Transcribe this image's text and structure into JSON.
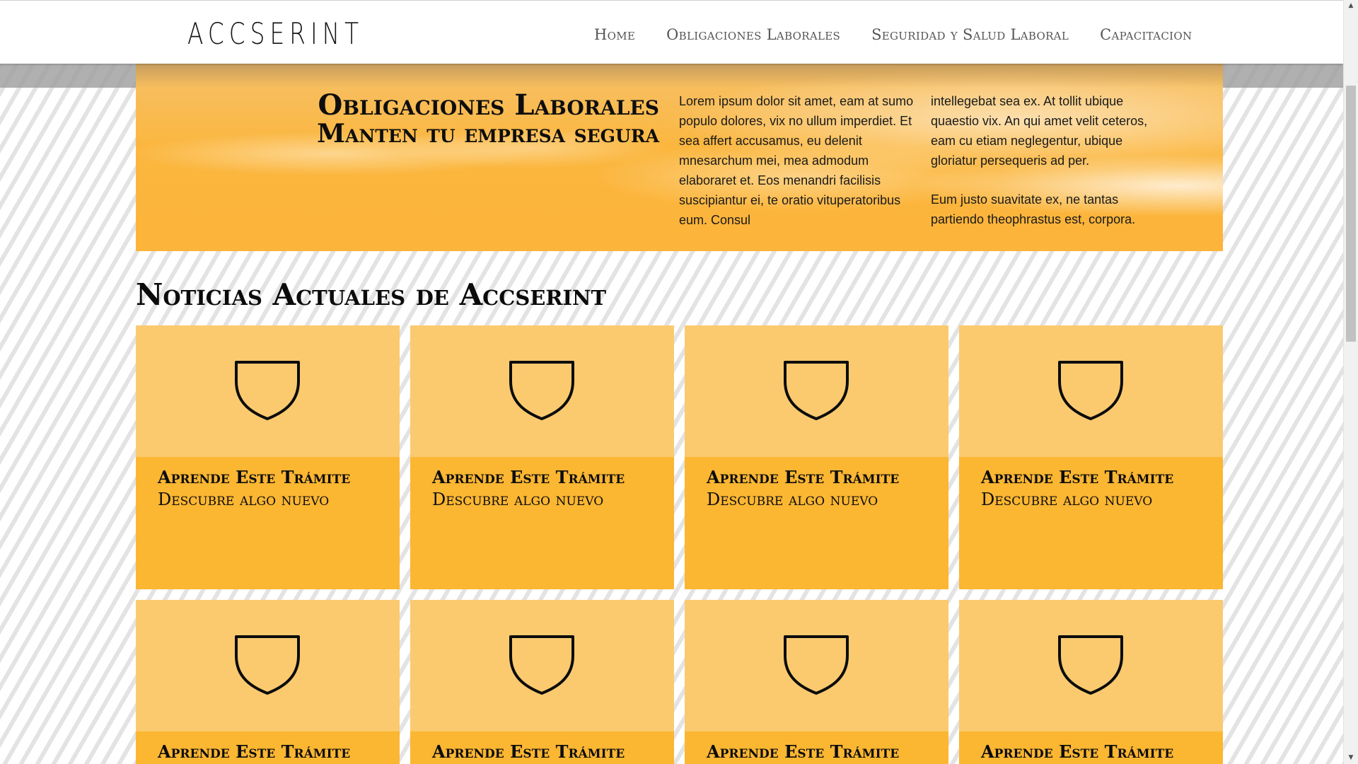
{
  "header": {
    "logo": "ACCSERINT",
    "nav": [
      {
        "label": "Home"
      },
      {
        "label": "Obligaciones Laborales"
      },
      {
        "label": "Seguridad y Salud Laboral"
      },
      {
        "label": "Capacitacion"
      }
    ]
  },
  "hero": {
    "title": "Obligaciones Laborales",
    "subtitle": "Manten tu empresa segura",
    "col1": "Lorem ipsum dolor sit amet, eam at sumo populo dolores, vix no ullum imperdiet. Et sea affert accusamus, eu delenit mnesarchum mei, mea admodum elaboraret et. Eos menandri facilisis suscipiantur ei, te oratio vituperatoribus eum. Consul",
    "col2_p1": "intellegebat sea ex. At tollit ubique quaestio vix. An qui amet velit ceteros, eam cu etiam neglegentur, ubique gloriatur persequeris ad per.",
    "col2_p2": "Eum justo suavitate ex, ne tantas partiendo theophrastus est, corpora."
  },
  "news": {
    "title": "Noticias Actuales de Accserint",
    "cards": [
      {
        "title": "Aprende Este Trámite",
        "subtitle": "Descubre algo nuevo",
        "icon": "shield-icon"
      },
      {
        "title": "Aprende Este Trámite",
        "subtitle": "Descubre algo nuevo",
        "icon": "shield-icon"
      },
      {
        "title": "Aprende Este Trámite",
        "subtitle": "Descubre algo nuevo",
        "icon": "shield-icon"
      },
      {
        "title": "Aprende Este Trámite",
        "subtitle": "Descubre algo nuevo",
        "icon": "shield-icon"
      },
      {
        "title": "Aprende Este Trámite",
        "subtitle": "",
        "icon": "shield-icon"
      },
      {
        "title": "Aprende Este Trámite",
        "subtitle": "",
        "icon": "shield-icon"
      },
      {
        "title": "Aprende Este Trámite",
        "subtitle": "",
        "icon": "shield-icon"
      },
      {
        "title": "Aprende Este Trámite",
        "subtitle": "",
        "icon": "shield-icon"
      }
    ]
  },
  "colors": {
    "card_top": "#fbca6f",
    "card_bottom": "#fbb632",
    "hero_accent": "#fbb63e"
  }
}
